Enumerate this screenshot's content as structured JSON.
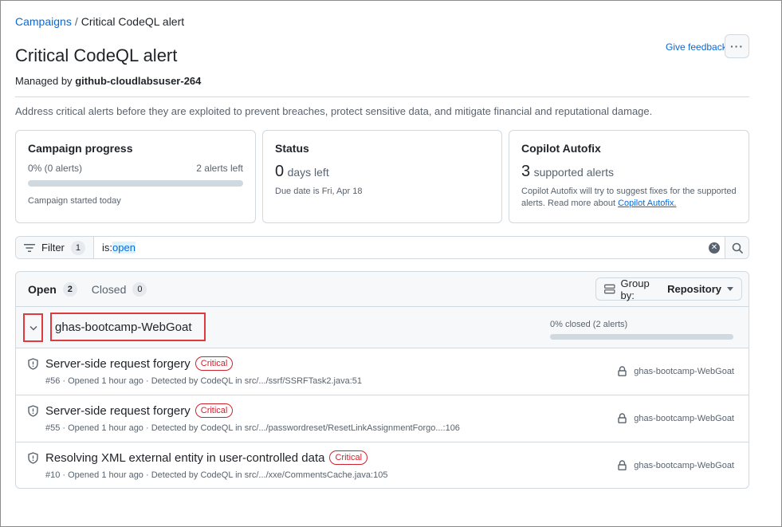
{
  "breadcrumb": {
    "parent": "Campaigns",
    "separator": "/",
    "current": "Critical CodeQL alert"
  },
  "header": {
    "title": "Critical CodeQL alert",
    "managed_prefix": "Managed by",
    "managed_by": "github-cloudlabsuser-264",
    "feedback_label": "Give feedback",
    "more_label": "···"
  },
  "description": "Address critical alerts before they are exploited to prevent breaches, protect sensitive data, and mitigate financial and reputational damage.",
  "cards": {
    "progress": {
      "title": "Campaign progress",
      "percent_text": "0% (0 alerts)",
      "left_text": "2 alerts left",
      "progress_fraction": 0,
      "note": "Campaign started today"
    },
    "status": {
      "title": "Status",
      "value": "0",
      "unit": "days left",
      "note": "Due date is Fri, Apr 18"
    },
    "autofix": {
      "title": "Copilot Autofix",
      "value": "3",
      "unit": "supported alerts",
      "note": "Copilot Autofix will try to suggest fixes for the supported alerts. Read more about",
      "link": "Copilot Autofix."
    }
  },
  "filter": {
    "label": "Filter",
    "count": "1",
    "query_key": "is:",
    "query_value": "open"
  },
  "alerts": {
    "tabs": [
      {
        "label": "Open",
        "count": "2"
      },
      {
        "label": "Closed",
        "count": "0"
      }
    ],
    "group_by_prefix": "Group by:",
    "group_by_value": "Repository",
    "group": {
      "name": "ghas-bootcamp-WebGoat",
      "stat": "0% closed (2 alerts)",
      "closed_fraction": 0
    },
    "items": [
      {
        "title": "Server-side request forgery",
        "severity": "Critical",
        "meta": "#56 · Opened 1 hour ago · Detected by CodeQL in src/.../ssrf/SSRFTask2.java:51",
        "repo": "ghas-bootcamp-WebGoat"
      },
      {
        "title": "Server-side request forgery",
        "severity": "Critical",
        "meta": "#55 · Opened 1 hour ago · Detected by CodeQL in src/.../passwordreset/ResetLinkAssignmentForgo...:106",
        "repo": "ghas-bootcamp-WebGoat"
      },
      {
        "title": "Resolving XML external entity in user-controlled data",
        "severity": "Critical",
        "meta": "#10 · Opened 1 hour ago · Detected by CodeQL in src/.../xxe/CommentsCache.java:105",
        "repo": "ghas-bootcamp-WebGoat"
      }
    ]
  },
  "colors": {
    "link": "#0969da",
    "critical": "#cf222e",
    "highlight_box": "#e0393e",
    "border": "#d1d9e0"
  }
}
